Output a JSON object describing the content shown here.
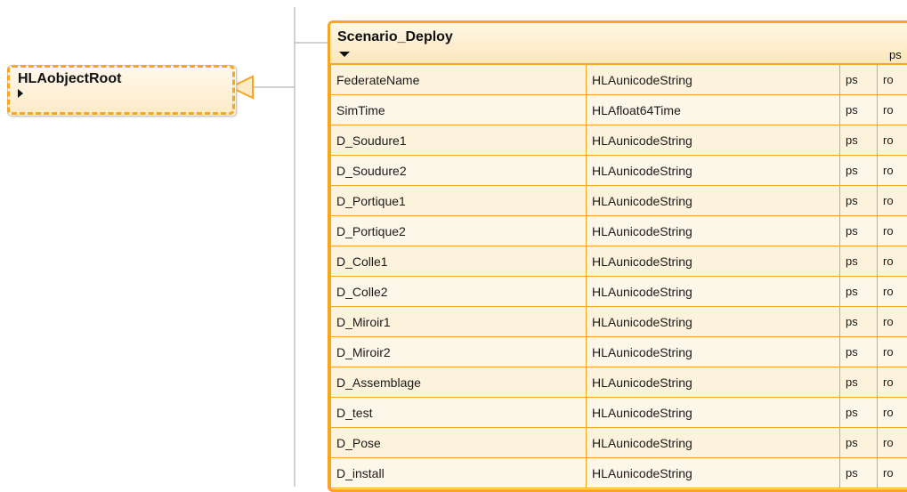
{
  "root_class": {
    "name": "HLAobjectRoot"
  },
  "object_class": {
    "name": "Scenario_Deploy",
    "header_extra": "ps",
    "attributes": [
      {
        "name": "FederateName",
        "type": "HLAunicodeString",
        "sharing": "ps",
        "order": "ro"
      },
      {
        "name": "SimTime",
        "type": "HLAfloat64Time",
        "sharing": "ps",
        "order": "ro"
      },
      {
        "name": "D_Soudure1",
        "type": "HLAunicodeString",
        "sharing": "ps",
        "order": "ro"
      },
      {
        "name": "D_Soudure2",
        "type": "HLAunicodeString",
        "sharing": "ps",
        "order": "ro"
      },
      {
        "name": "D_Portique1",
        "type": "HLAunicodeString",
        "sharing": "ps",
        "order": "ro"
      },
      {
        "name": "D_Portique2",
        "type": "HLAunicodeString",
        "sharing": "ps",
        "order": "ro"
      },
      {
        "name": "D_Colle1",
        "type": "HLAunicodeString",
        "sharing": "ps",
        "order": "ro"
      },
      {
        "name": "D_Colle2",
        "type": "HLAunicodeString",
        "sharing": "ps",
        "order": "ro"
      },
      {
        "name": "D_Miroir1",
        "type": "HLAunicodeString",
        "sharing": "ps",
        "order": "ro"
      },
      {
        "name": "D_Miroir2",
        "type": "HLAunicodeString",
        "sharing": "ps",
        "order": "ro"
      },
      {
        "name": "D_Assemblage",
        "type": "HLAunicodeString",
        "sharing": "ps",
        "order": "ro"
      },
      {
        "name": "D_test",
        "type": "HLAunicodeString",
        "sharing": "ps",
        "order": "ro"
      },
      {
        "name": "D_Pose",
        "type": "HLAunicodeString",
        "sharing": "ps",
        "order": "ro"
      },
      {
        "name": "D_install",
        "type": "HLAunicodeString",
        "sharing": "ps",
        "order": "ro"
      }
    ]
  },
  "colors": {
    "accent": "#f5a623",
    "node_fill": "#fdf3dc",
    "connector": "#a6a6a6"
  }
}
